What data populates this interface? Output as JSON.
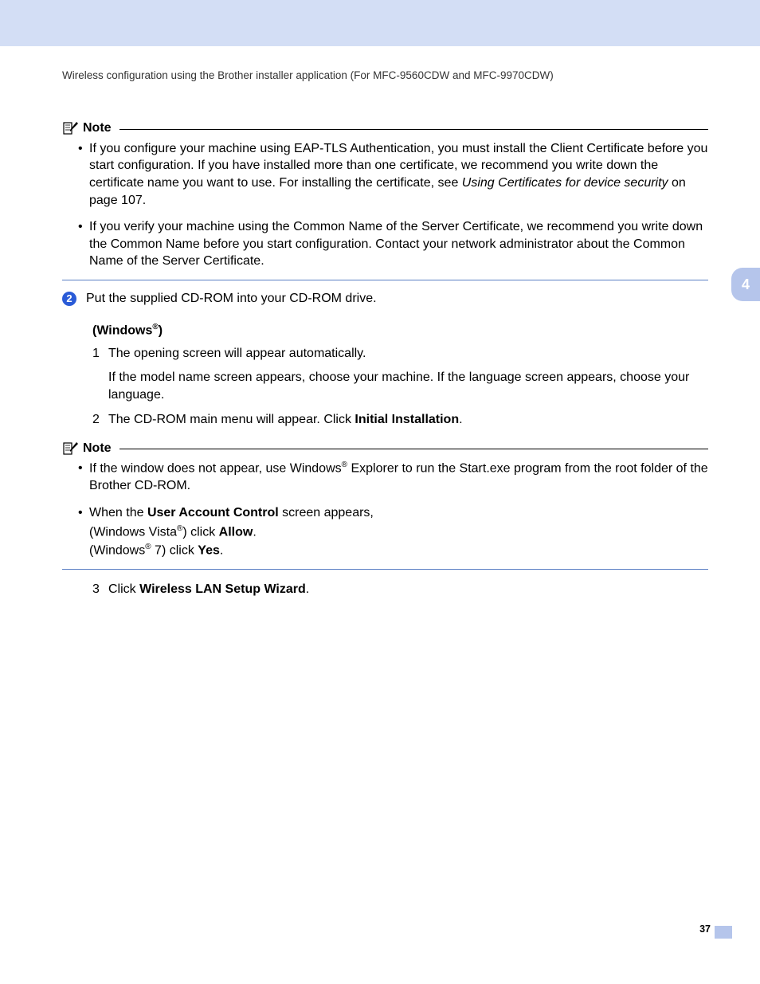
{
  "header": "Wireless configuration using the Brother installer application (For MFC-9560CDW and MFC-9970CDW)",
  "chapter": "4",
  "page_number": "37",
  "note1": {
    "label": "Note",
    "items": [
      {
        "pre": "If you configure your machine using EAP-TLS Authentication, you must install the Client Certificate before you start configuration. If you have installed more than one certificate, we recommend you write down the certificate name you want to use. For installing the certificate, see ",
        "italic": "Using Certificates for device security",
        "post": " on page 107."
      },
      {
        "pre": "If you verify your machine using the Common Name of the Server Certificate, we recommend you write down the Common Name before you start configuration. Contact your network administrator about the Common Name of the Server Certificate.",
        "italic": "",
        "post": ""
      }
    ]
  },
  "step2": {
    "number": "2",
    "text": "Put the supplied CD-ROM into your CD-ROM drive."
  },
  "windows": {
    "heading_pre": "(Windows",
    "heading_post": ")",
    "sub": [
      {
        "num": "1",
        "text": "The opening screen will appear automatically.",
        "para": "If the model name screen appears, choose your machine. If the language screen appears, choose your language."
      },
      {
        "num": "2",
        "pre": "The CD-ROM main menu will appear. Click ",
        "bold": "Initial Installation",
        "post": "."
      }
    ]
  },
  "note2": {
    "label": "Note",
    "items": [
      {
        "line1_pre": "If the window does not appear, use Windows",
        "line1_post": " Explorer to run the Start.exe program from the root folder of the Brother CD-ROM."
      },
      {
        "line1_pre": "When the ",
        "line1_bold": "User Account Control",
        "line1_post": " screen appears,",
        "line2_pre": "(Windows Vista",
        "line2_mid": ") click ",
        "line2_bold": "Allow",
        "line2_post": ".",
        "line3_pre": "(Windows",
        "line3_mid": " 7) click ",
        "line3_bold": "Yes",
        "line3_post": "."
      }
    ]
  },
  "sub3": {
    "num": "3",
    "pre": "Click ",
    "bold": "Wireless LAN Setup Wizard",
    "post": "."
  }
}
